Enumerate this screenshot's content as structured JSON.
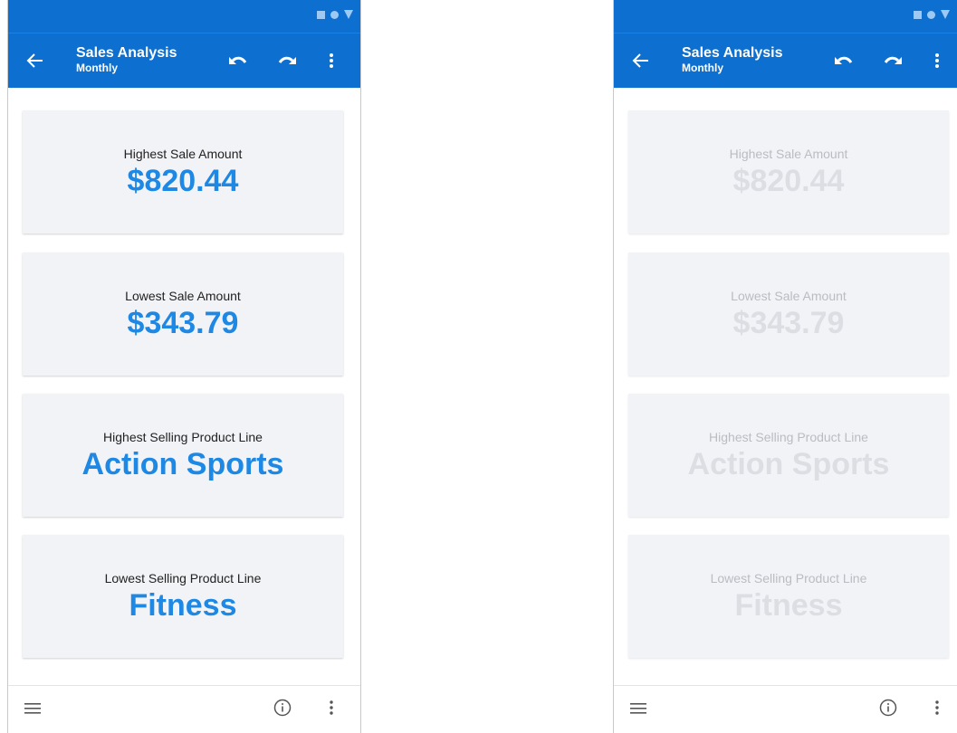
{
  "app": {
    "title": "Sales Analysis",
    "subtitle": "Monthly"
  },
  "colors": {
    "primary": "#0d6fcf",
    "value_blue": "#1e88e5",
    "card_bg": "#f2f3f7"
  },
  "icons": {
    "back": "arrow-left-icon",
    "undo": "undo-icon",
    "redo": "redo-icon",
    "more": "more-vert-icon",
    "menu": "hamburger-menu-icon",
    "info": "info-icon"
  },
  "cards": [
    {
      "label": "Highest Sale Amount",
      "value": "$820.44"
    },
    {
      "label": "Lowest Sale Amount",
      "value": "$343.79"
    },
    {
      "label": "Highest Selling Product Line",
      "value": "Action Sports"
    },
    {
      "label": "Lowest Selling Product Line",
      "value": "Fitness"
    }
  ]
}
